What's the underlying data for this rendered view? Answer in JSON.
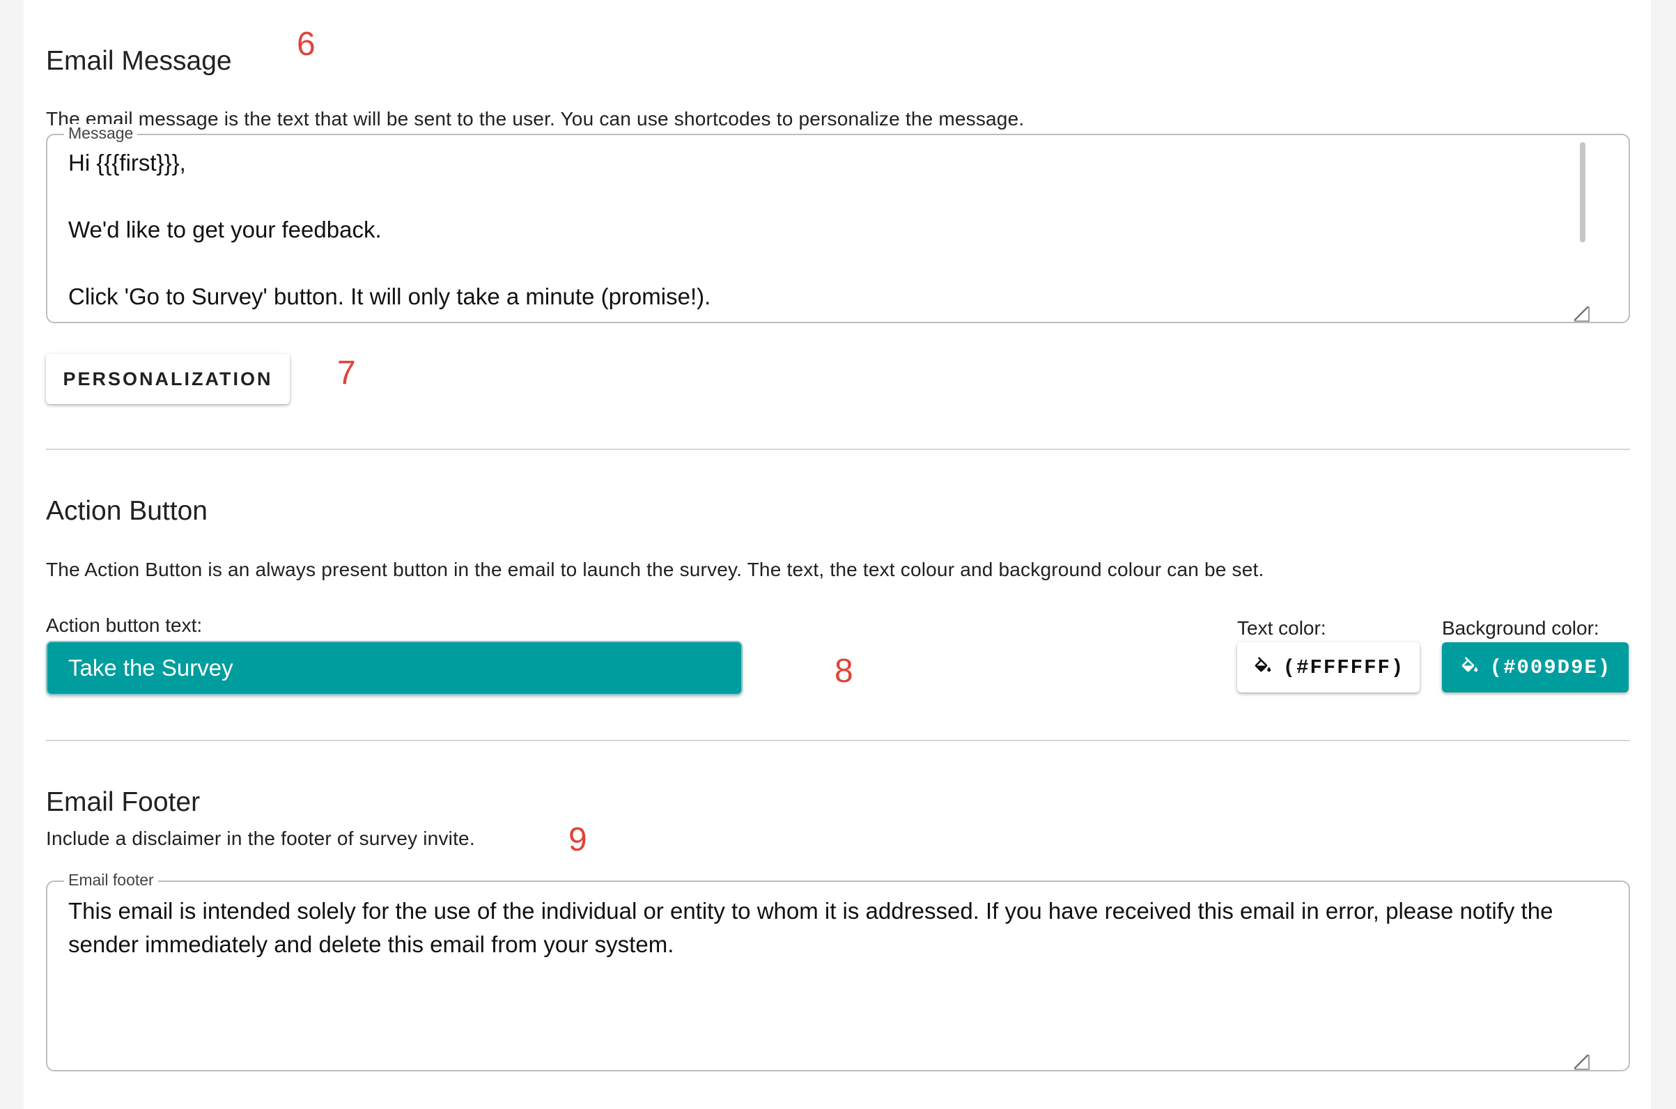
{
  "colors": {
    "accent": "#009D9E",
    "annotation": "#E0443A",
    "text_color_value": "#FFFFFF",
    "background_color_value": "#009D9E"
  },
  "email_message": {
    "annotation": "6",
    "heading": "Email Message",
    "description": "The email message is the text that will be sent to the user. You can use shortcodes to personalize the message.",
    "field_label": "Message",
    "value": "Hi {{{first}}},\n\nWe'd like to get your feedback.\n\nClick 'Go to Survey' button. It will only take a minute (promise!)."
  },
  "personalization": {
    "annotation": "7",
    "button_label": "PERSONALIZATION"
  },
  "action_button": {
    "heading": "Action Button",
    "description": "The Action Button is an always present button in the email to launch the survey. The text, the text colour and background colour can be set.",
    "text_label": "Action button text:",
    "text_value": "Take the Survey",
    "annotation": "8",
    "text_color_label": "Text color:",
    "text_color_button": "(#FFFFFF)",
    "bg_color_label": "Background color:",
    "bg_color_button": "(#009D9E)",
    "paint_icon": "format-color-fill-icon"
  },
  "email_footer": {
    "heading": "Email Footer",
    "description": "Include a disclaimer in the footer of survey invite.",
    "annotation": "9",
    "field_label": "Email footer",
    "value": "This email is intended solely for the use of the individual or entity to whom it is addressed. If you have received this email in error, please notify the sender immediately and delete this email from your system."
  }
}
